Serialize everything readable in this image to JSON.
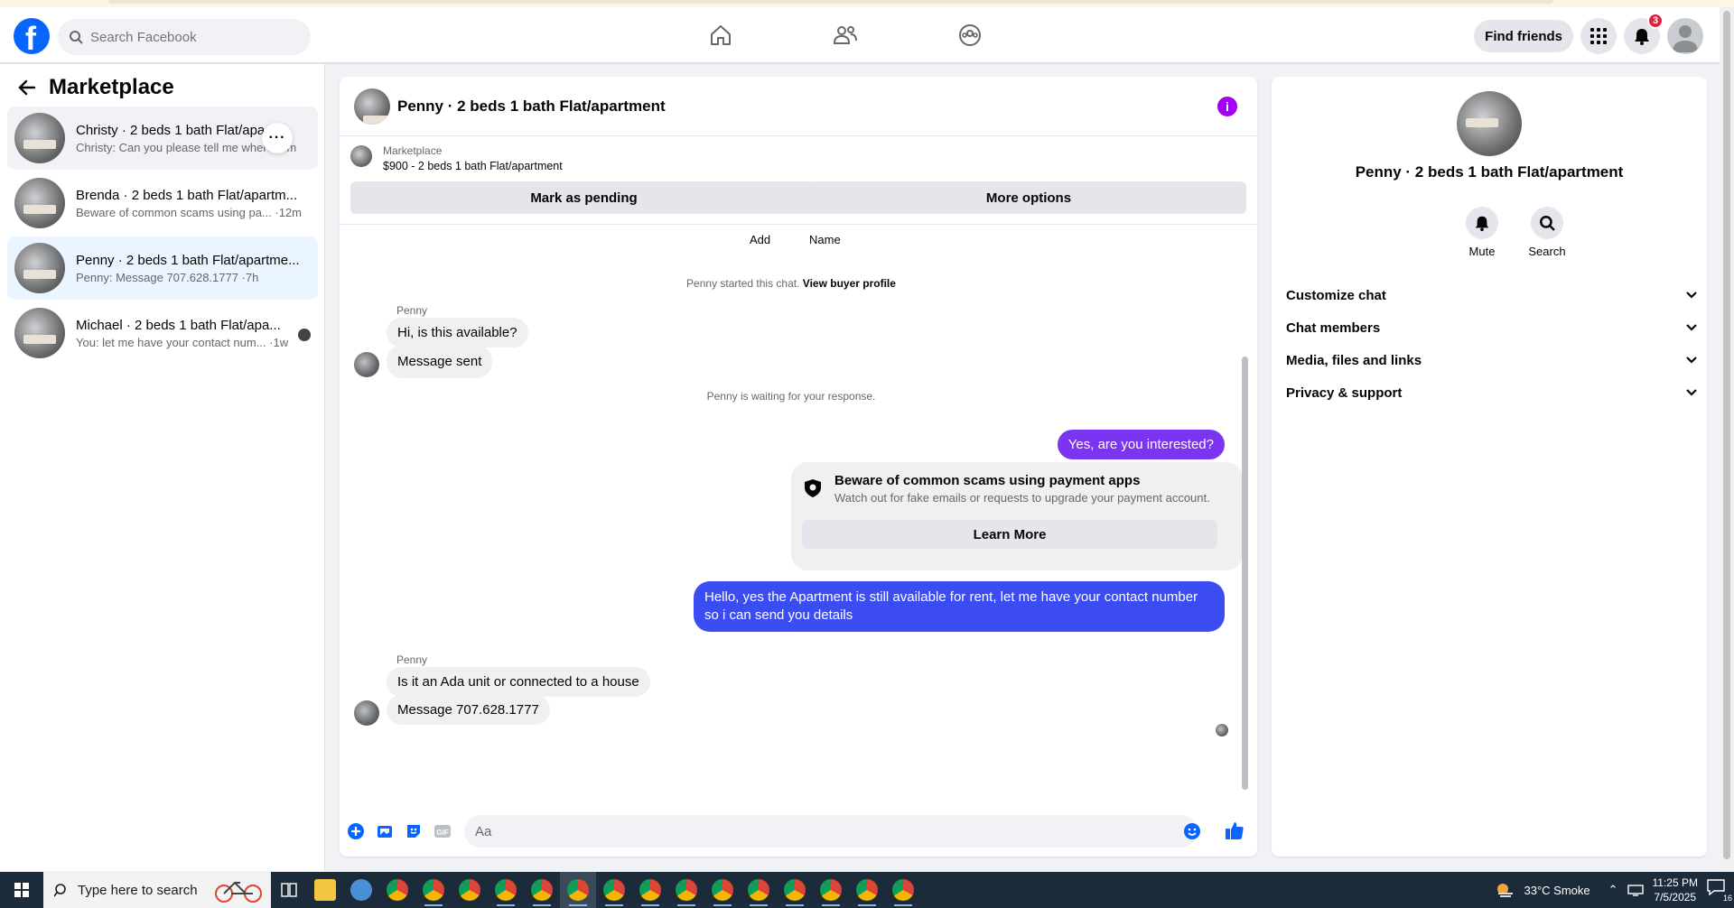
{
  "header": {
    "search_placeholder": "Search Facebook",
    "find_friends": "Find friends",
    "notifications_count": "3"
  },
  "sidebar": {
    "title": "Marketplace",
    "conversations": [
      {
        "name": "Christy · 2 beds 1 bath Flat/apa...",
        "sub": "Christy: Can you please tell me where... m"
      },
      {
        "name": "Brenda · 2 beds 1 bath Flat/apartm...",
        "sub": "Beware of common scams using pa... ·12m"
      },
      {
        "name": "Penny · 2 beds 1 bath Flat/apartme...",
        "sub": "Penny: Message 707.628.1777 ·7h"
      },
      {
        "name": "Michael · 2 beds 1 bath Flat/apa...",
        "sub": "You: let me have your contact num... ·1w"
      }
    ]
  },
  "chat": {
    "title": "Penny · 2 beds 1 bath Flat/apartment",
    "listing_category": "Marketplace",
    "listing_price": "$900 - 2 beds 1 bath Flat/apartment",
    "mark_pending": "Mark as pending",
    "more_options": "More options",
    "top_add": "Add",
    "top_name": "Name",
    "started_note": "Penny started this chat.",
    "view_profile": "View buyer profile",
    "sender_name_1": "Penny",
    "msg_1": "Hi, is this available?",
    "msg_2": "Message sent",
    "waiting_note": "Penny is waiting for your response.",
    "out_1": "Yes, are you interested?",
    "scam_title": "Beware of common scams using payment apps",
    "scam_body": "Watch out for fake emails or requests to upgrade your payment account.",
    "learn_more": "Learn More",
    "out_2": "Hello, yes the Apartment is still available for rent, let me have your contact number so i can send you details",
    "sender_name_2": "Penny",
    "msg_3": "Is it an Ada unit or connected to a house",
    "msg_4": "Message 707.628.1777",
    "composer_placeholder": "Aa"
  },
  "panel": {
    "title": "Penny · 2 beds 1 bath Flat/apartment",
    "mute": "Mute",
    "search": "Search",
    "sections": [
      "Customize chat",
      "Chat members",
      "Media, files and links",
      "Privacy & support"
    ]
  },
  "taskbar": {
    "search_placeholder": "Type here to search",
    "weather": "33°C  Smoke",
    "time": "11:25 PM",
    "date": "7/5/2025",
    "notif_count": "16"
  },
  "colors": {
    "brand": "#0866ff",
    "out_bubble_1": "#7b35f0",
    "out_bubble_2": "#3a4cf2",
    "info": "#a100f2"
  }
}
